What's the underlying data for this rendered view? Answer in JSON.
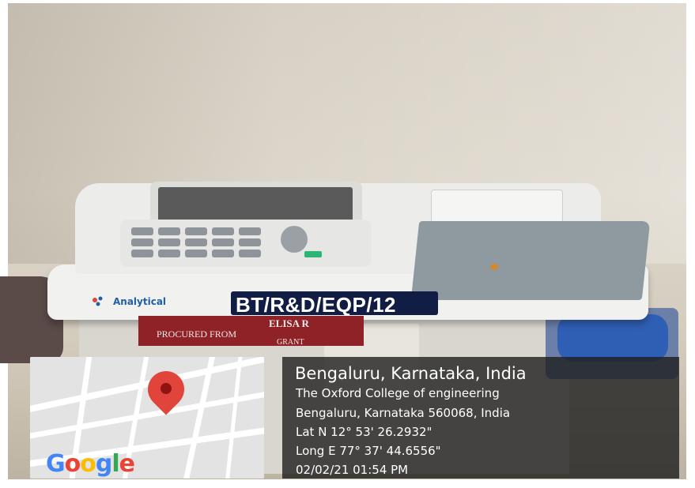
{
  "photo": {
    "subject": "Analytical ELISA reader on laboratory bench",
    "asset_tag": "BT/R&D/EQP/12",
    "brand": "Analytical",
    "label_line1": "ELISA R",
    "label_line2": "PROCURED FROM",
    "label_line3": "GRANT"
  },
  "map": {
    "provider": "Google",
    "pin_icon": "location-pin-icon",
    "pin_color": "#e0443a"
  },
  "location": {
    "title": "Bengaluru, Karnataka, India",
    "place": "The Oxford College of engineering",
    "address": "Bengaluru, Karnataka 560068, India",
    "lat": "Lat N 12° 53' 26.2932\"",
    "long": "Long E 77° 37' 44.6556\"",
    "timestamp": "02/02/21 01:54 PM"
  }
}
